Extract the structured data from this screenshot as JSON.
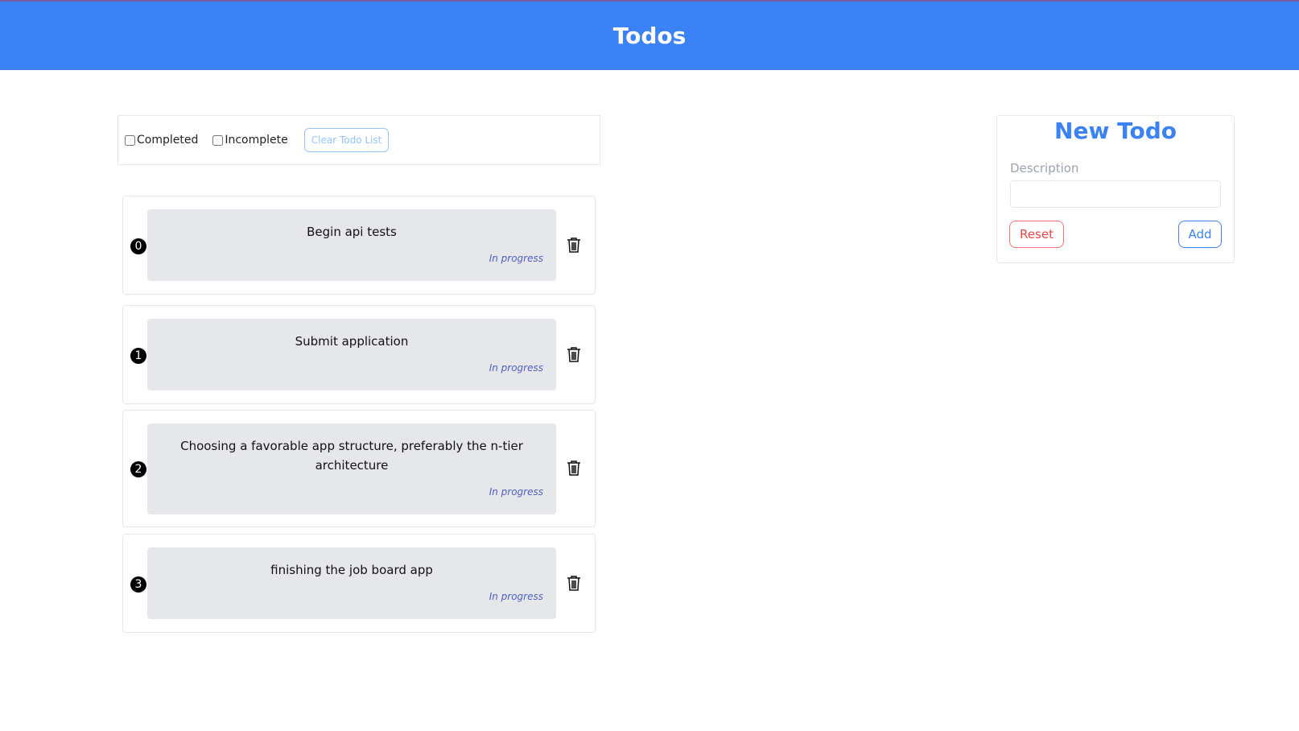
{
  "header": {
    "title": "Todos"
  },
  "filters": {
    "completed_label": "Completed",
    "incomplete_label": "Incomplete",
    "clear_label": "Clear Todo List"
  },
  "todos": [
    {
      "index": "0",
      "description": "Begin api tests",
      "status": "In progress"
    },
    {
      "index": "1",
      "description": "Submit application",
      "status": "In progress"
    },
    {
      "index": "2",
      "description": "Choosing a favorable app structure, preferably the n-tier architecture",
      "status": "In progress"
    },
    {
      "index": "3",
      "description": "finishing the job board app",
      "status": "In progress"
    }
  ],
  "new_todo": {
    "title": "New Todo",
    "description_label": "Description",
    "description_value": "",
    "reset_label": "Reset",
    "add_label": "Add"
  },
  "colors": {
    "accent": "#3b82f6",
    "danger": "#ef4444",
    "status_text": "#4f5fc0"
  },
  "icons": {
    "delete": "trash-icon"
  }
}
